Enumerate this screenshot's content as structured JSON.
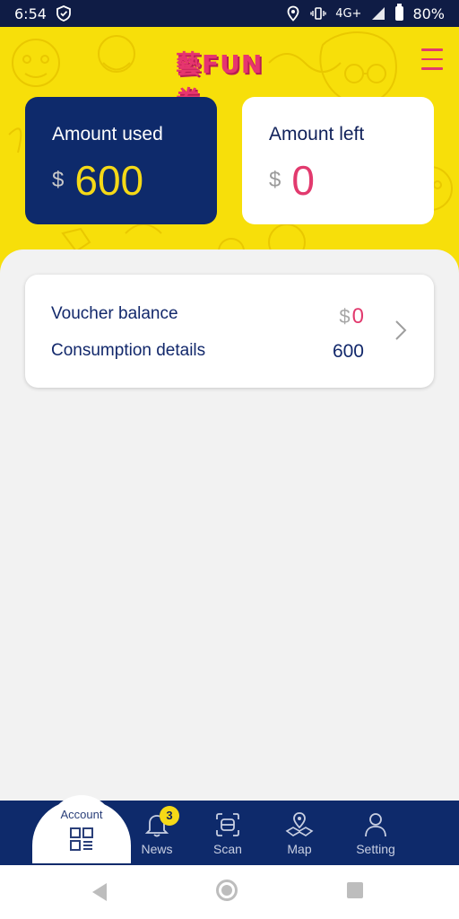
{
  "status_bar": {
    "time": "6:54",
    "network": "4G+",
    "battery": "80%"
  },
  "header": {
    "logo_text": "藝FUN券"
  },
  "cards": {
    "used": {
      "title": "Amount used",
      "currency": "$",
      "amount": "600"
    },
    "left": {
      "title": "Amount left",
      "currency": "$",
      "amount": "0"
    }
  },
  "summary": {
    "voucher_label": "Voucher balance",
    "voucher_currency": "$",
    "voucher_value": "0",
    "consumption_label": "Consumption details",
    "consumption_value": "600"
  },
  "bottom_nav": {
    "account": "Account",
    "news": "News",
    "news_badge": "3",
    "scan": "Scan",
    "map": "Map",
    "setting": "Setting"
  },
  "colors": {
    "yellow": "#f7df0a",
    "navy": "#0e2a6b",
    "pink": "#e23a6e"
  }
}
